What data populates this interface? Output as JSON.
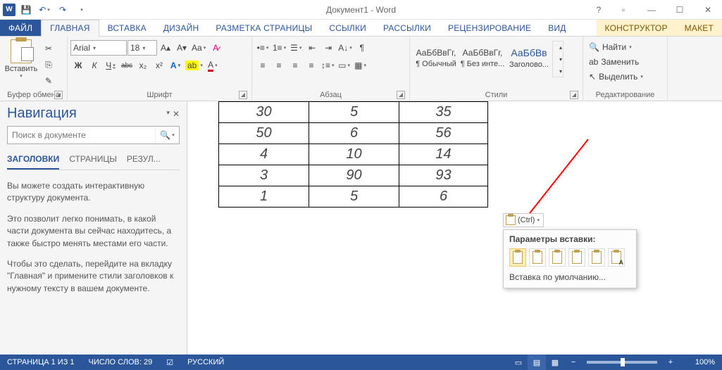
{
  "title": "Документ1 - Word",
  "qat": {
    "save": "save-icon",
    "undo": "undo-icon",
    "redo": "redo-icon",
    "customize": "customize-qat"
  },
  "tabs": {
    "file": "ФАЙЛ",
    "items": [
      "ГЛАВНАЯ",
      "ВСТАВКА",
      "ДИЗАЙН",
      "РАЗМЕТКА СТРАНИЦЫ",
      "ССЫЛКИ",
      "РАССЫЛКИ",
      "РЕЦЕНЗИРОВАНИЕ",
      "ВИД"
    ],
    "context": [
      "КОНСТРУКТОР",
      "МАКЕТ"
    ],
    "active_index": 0
  },
  "ribbon": {
    "clipboard": {
      "paste": "Вставить",
      "label": "Буфер обмена"
    },
    "font": {
      "name": "Arial",
      "size": "18",
      "b": "Ж",
      "i": "К",
      "u": "Ч",
      "strike": "abc",
      "sub": "x₂",
      "sup": "x²",
      "label": "Шрифт"
    },
    "paragraph": {
      "label": "Абзац"
    },
    "styles": {
      "items": [
        {
          "sample": "АаБбВвГг,",
          "name": "¶ Обычный"
        },
        {
          "sample": "АаБбВвГг,",
          "name": "¶ Без инте..."
        },
        {
          "sample": "АаБбВв",
          "name": "Заголово..."
        }
      ],
      "label": "Стили"
    },
    "editing": {
      "find": "Найти",
      "replace": "Заменить",
      "select": "Выделить",
      "label": "Редактирование"
    }
  },
  "nav": {
    "title": "Навигация",
    "search_placeholder": "Поиск в документе",
    "tabs": [
      "ЗАГОЛОВКИ",
      "СТРАНИЦЫ",
      "РЕЗУЛ..."
    ],
    "p1": "Вы можете создать интерактивную структуру документа.",
    "p2": "Это позволит легко понимать, в какой части документа вы сейчас находитесь, а также быстро менять местами его части.",
    "p3": "Чтобы это сделать, перейдите на вкладку \"Главная\" и примените стили заголовков к нужному тексту в вашем документе."
  },
  "table_rows": [
    [
      "30",
      "5",
      "35"
    ],
    [
      "50",
      "6",
      "56"
    ],
    [
      "4",
      "10",
      "14"
    ],
    [
      "3",
      "90",
      "93"
    ],
    [
      "1",
      "5",
      "6"
    ]
  ],
  "paste_tag": "(Ctrl)",
  "paste_popup": {
    "title": "Параметры вставки:",
    "default": "Вставка по умолчанию..."
  },
  "status": {
    "page": "СТРАНИЦА 1 ИЗ 1",
    "words": "ЧИСЛО СЛОВ: 29",
    "lang": "РУССКИЙ",
    "zoom": "100%"
  }
}
